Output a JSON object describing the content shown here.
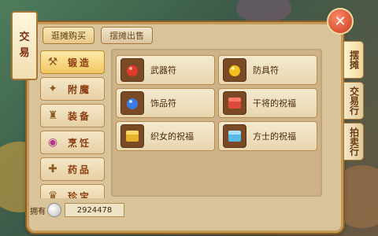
{
  "window": {
    "title_chars": [
      "交",
      "易"
    ]
  },
  "top_tabs": [
    {
      "label": "逛摊购买",
      "active": true
    },
    {
      "label": "摆摊出售",
      "active": false
    }
  ],
  "categories": [
    {
      "label": "锻造",
      "icon": "hammer-icon",
      "selected": true
    },
    {
      "label": "附魔",
      "icon": "sparkle-icon",
      "selected": false
    },
    {
      "label": "装备",
      "icon": "helmet-icon",
      "selected": false
    },
    {
      "label": "烹饪",
      "icon": "pot-icon",
      "selected": false
    },
    {
      "label": "药品",
      "icon": "medicine-icon",
      "selected": false
    },
    {
      "label": "珍宝",
      "icon": "treasure-icon",
      "selected": false
    }
  ],
  "items": [
    {
      "name": "武器符",
      "icon": "red-gem-icon",
      "color": "#e33b2b"
    },
    {
      "name": "防具符",
      "icon": "yellow-gem-icon",
      "color": "#f3c21b"
    },
    {
      "name": "饰品符",
      "icon": "blue-gem-icon",
      "color": "#3a7be8"
    },
    {
      "name": "干将的祝福",
      "icon": "red-chest-icon",
      "color": "#e04a3a"
    },
    {
      "name": "织女的祝福",
      "icon": "gold-chest-icon",
      "color": "#e7b32a"
    },
    {
      "name": "方士的祝福",
      "icon": "blue-chest-icon",
      "color": "#57b9e8"
    }
  ],
  "side_tabs": [
    {
      "label": "摆摊",
      "active": true
    },
    {
      "label": "交易行",
      "active": false
    },
    {
      "label": "拍卖行",
      "active": false
    }
  ],
  "footer": {
    "label": "拥有",
    "amount": "2924478"
  },
  "close_label": "✕"
}
